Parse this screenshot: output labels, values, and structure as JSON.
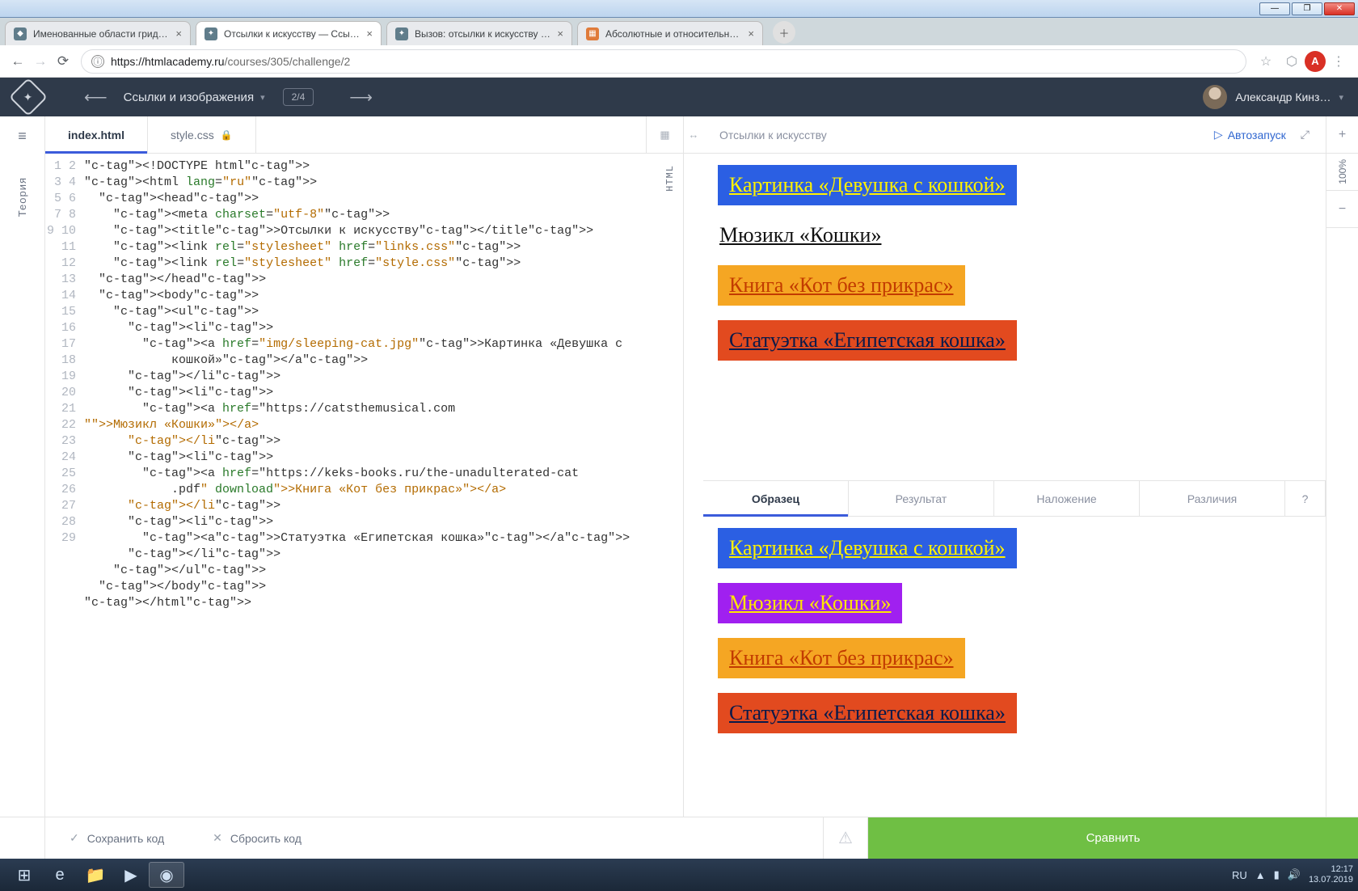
{
  "window_buttons": {
    "min": "—",
    "max": "❐",
    "close": "✕"
  },
  "tabs": [
    {
      "label": "Именованные области грида: с",
      "fav": "⬛"
    },
    {
      "label": "Отсылки к искусству — Ссылки",
      "fav": "✦",
      "active": true
    },
    {
      "label": "Вызов: отсылки к искусству - К",
      "fav": "✦"
    },
    {
      "label": "Абсолютные и относительные",
      "fav": "▦"
    }
  ],
  "newtab": "＋",
  "nav": {
    "back": "←",
    "forward": "→",
    "reload": "⟳",
    "info": "ⓘ",
    "star": "☆",
    "shield": "⬡",
    "menu": "⋮"
  },
  "url": {
    "host": "https://htmlacademy.ru",
    "path": "/courses/305/challenge/2"
  },
  "avatar_letter": "A",
  "header": {
    "arrow_left": "⟵",
    "arrow_right": "⟶",
    "title": "Ссылки и изображения",
    "chev": "▾",
    "counter": "2/4",
    "user": "Александр Кинз…"
  },
  "left_rail": {
    "burger": "≡",
    "label": "Теория"
  },
  "file_tabs": {
    "file1": "index.html",
    "file2": "style.css",
    "lock": "🔒",
    "grid": "▦",
    "handle": "↔"
  },
  "code_vlabel": "HTML",
  "code_lines": [
    "<!DOCTYPE html>",
    "<html lang=\"ru\">",
    "  <head>",
    "    <meta charset=\"utf-8\">",
    "    <title>Отсылки к искусству</title>",
    "    <link rel=\"stylesheet\" href=\"links.css\">",
    "    <link rel=\"stylesheet\" href=\"style.css\">",
    "  </head>",
    "  <body>",
    "    <ul>",
    "      <li>",
    "        <a href=\"img/sleeping-cat.jpg\">Картинка «Девушка с",
    "            кошкой»</a>",
    "      </li>",
    "      <li>",
    "        <a href=\"https://catsthemusical.com",
    "\">Мюзикл «Кошки»</a>",
    "      </li>",
    "      <li>",
    "        <a href=\"https://keks-books.ru/the-unadulterated-cat",
    "            .pdf\" download>Книга «Кот без прикрас»</a>",
    "      </li>",
    "      <li>",
    "        <a>Статуэтка «Египетская кошка»</a>",
    "      </li>",
    "    </ul>",
    "  </body>",
    "</html>",
    ""
  ],
  "preview": {
    "title": "Отсылки к искусству",
    "auto": "Автозапуск",
    "auto_icon": "▷",
    "expand": "⤢",
    "items_top": [
      {
        "text": "Картинка «Девушка с кошкой»",
        "cls": "lnk-box lnk-blue"
      },
      {
        "text": "Мюзикл «Кошки»",
        "cls": "lnk-plain"
      },
      {
        "text": "Книга «Кот без прикрас»",
        "cls": "lnk-box lnk-orange"
      },
      {
        "text": "Статуэтка «Египетская кошка»",
        "cls": "lnk-box lnk-red"
      }
    ],
    "sample_tabs": [
      "Образец",
      "Результат",
      "Наложение",
      "Различия"
    ],
    "q": "?",
    "items_sample": [
      {
        "text": "Картинка «Девушка с кошкой»",
        "cls": "lnk-box lnk-blue"
      },
      {
        "text": "Мюзикл «Кошки»",
        "cls": "lnk-box lnk-purple"
      },
      {
        "text": "Книга «Кот без прикрас»",
        "cls": "lnk-box lnk-orange"
      },
      {
        "text": "Статуэтка «Египетская кошка»",
        "cls": "lnk-box lnk-red"
      }
    ]
  },
  "side_rail": {
    "plus": "+",
    "percent": "100%",
    "minus": "−"
  },
  "footer": {
    "save_icon": "✓",
    "save": "Сохранить код",
    "reset_icon": "✕",
    "reset": "Сбросить код",
    "warn": "⚠",
    "compare": "Сравнить"
  },
  "taskbar": {
    "lang": "RU",
    "flag": "▲",
    "net": "▮",
    "vol": "🔊",
    "time": "12:17",
    "date": "13.07.2019"
  }
}
